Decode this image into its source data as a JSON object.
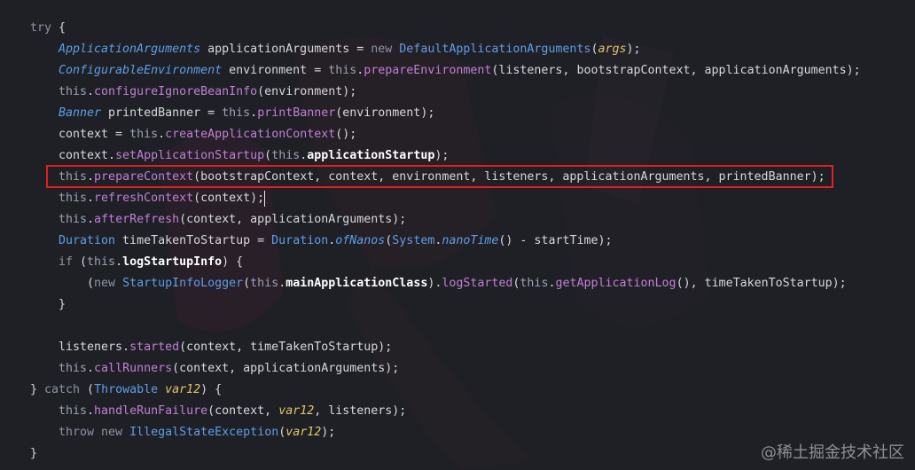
{
  "code": {
    "lines": [
      [
        [
          "k",
          "try"
        ],
        [
          "p",
          " {"
        ]
      ],
      [
        [
          "t",
          "ApplicationArguments"
        ],
        [
          "p",
          " applicationArguments = "
        ],
        [
          "k",
          "new"
        ],
        [
          "p",
          " "
        ],
        [
          "c",
          "DefaultApplicationArguments"
        ],
        [
          "p",
          "("
        ],
        [
          "v",
          "args"
        ],
        [
          "p",
          ");"
        ]
      ],
      [
        [
          "t",
          "ConfigurableEnvironment"
        ],
        [
          "p",
          " environment = "
        ],
        [
          "th",
          "this"
        ],
        [
          "p",
          "."
        ],
        [
          "m",
          "prepareEnvironment"
        ],
        [
          "p",
          "(listeners, bootstrapContext, applicationArguments);"
        ]
      ],
      [
        [
          "th",
          "this"
        ],
        [
          "p",
          "."
        ],
        [
          "m",
          "configureIgnoreBeanInfo"
        ],
        [
          "p",
          "(environment);"
        ]
      ],
      [
        [
          "t",
          "Banner"
        ],
        [
          "p",
          " printedBanner = "
        ],
        [
          "th",
          "this"
        ],
        [
          "p",
          "."
        ],
        [
          "m",
          "printBanner"
        ],
        [
          "p",
          "(environment);"
        ]
      ],
      [
        [
          "p",
          "context = "
        ],
        [
          "th",
          "this"
        ],
        [
          "p",
          "."
        ],
        [
          "m",
          "createApplicationContext"
        ],
        [
          "p",
          "();"
        ]
      ],
      [
        [
          "p",
          "context."
        ],
        [
          "m",
          "setApplicationStartup"
        ],
        [
          "p",
          "("
        ],
        [
          "th",
          "this"
        ],
        [
          "p",
          "."
        ],
        [
          "f",
          "applicationStartup"
        ],
        [
          "p",
          ");"
        ]
      ],
      [
        [
          "th",
          "this"
        ],
        [
          "p",
          "."
        ],
        [
          "m",
          "prepareContext"
        ],
        [
          "p",
          "(bootstrapContext, context, environment, listeners, applicationArguments, printedBanner);"
        ]
      ],
      [
        [
          "th",
          "this"
        ],
        [
          "p",
          "."
        ],
        [
          "m",
          "refreshContext"
        ],
        [
          "p",
          "(context);"
        ]
      ],
      [
        [
          "th",
          "this"
        ],
        [
          "p",
          "."
        ],
        [
          "m",
          "afterRefresh"
        ],
        [
          "p",
          "(context, applicationArguments);"
        ]
      ],
      [
        [
          "c",
          "Duration"
        ],
        [
          "p",
          " timeTakenToStartup = "
        ],
        [
          "c",
          "Duration"
        ],
        [
          "p",
          "."
        ],
        [
          "sm",
          "ofNanos"
        ],
        [
          "p",
          "("
        ],
        [
          "c",
          "System"
        ],
        [
          "p",
          "."
        ],
        [
          "sm",
          "nanoTime"
        ],
        [
          "p",
          "() - startTime);"
        ]
      ],
      [
        [
          "k",
          "if"
        ],
        [
          "p",
          " ("
        ],
        [
          "th",
          "this"
        ],
        [
          "p",
          "."
        ],
        [
          "f",
          "logStartupInfo"
        ],
        [
          "p",
          ") {"
        ]
      ],
      [
        [
          "p",
          "("
        ],
        [
          "k",
          "new"
        ],
        [
          "p",
          " "
        ],
        [
          "c",
          "StartupInfoLogger"
        ],
        [
          "p",
          "("
        ],
        [
          "th",
          "this"
        ],
        [
          "p",
          "."
        ],
        [
          "f",
          "mainApplicationClass"
        ],
        [
          "p",
          ")."
        ],
        [
          "m",
          "logStarted"
        ],
        [
          "p",
          "("
        ],
        [
          "th",
          "this"
        ],
        [
          "p",
          "."
        ],
        [
          "m",
          "getApplicationLog"
        ],
        [
          "p",
          "(), timeTakenToStartup);"
        ]
      ],
      [
        [
          "p",
          "}"
        ]
      ],
      [],
      [
        [
          "p",
          "listeners."
        ],
        [
          "m",
          "started"
        ],
        [
          "p",
          "(context, timeTakenToStartup);"
        ]
      ],
      [
        [
          "th",
          "this"
        ],
        [
          "p",
          "."
        ],
        [
          "m",
          "callRunners"
        ],
        [
          "p",
          "(context, applicationArguments);"
        ]
      ],
      [
        [
          "p",
          "} "
        ],
        [
          "k",
          "catch"
        ],
        [
          "p",
          " ("
        ],
        [
          "c",
          "Throwable"
        ],
        [
          "p",
          " "
        ],
        [
          "v",
          "var12"
        ],
        [
          "p",
          ") {"
        ]
      ],
      [
        [
          "th",
          "this"
        ],
        [
          "p",
          "."
        ],
        [
          "m",
          "handleRunFailure"
        ],
        [
          "p",
          "(context, "
        ],
        [
          "v",
          "var12"
        ],
        [
          "p",
          ", listeners);"
        ]
      ],
      [
        [
          "k",
          "throw"
        ],
        [
          "p",
          " "
        ],
        [
          "k",
          "new"
        ],
        [
          "p",
          " "
        ],
        [
          "c",
          "IllegalStateException"
        ],
        [
          "p",
          "("
        ],
        [
          "v",
          "var12"
        ],
        [
          "p",
          ");"
        ]
      ],
      [
        [
          "p",
          "}"
        ]
      ]
    ]
  },
  "watermark": "@稀土掘金技术社区",
  "colors": {
    "highlight_border": "#e02020",
    "background": "#1f2026"
  }
}
